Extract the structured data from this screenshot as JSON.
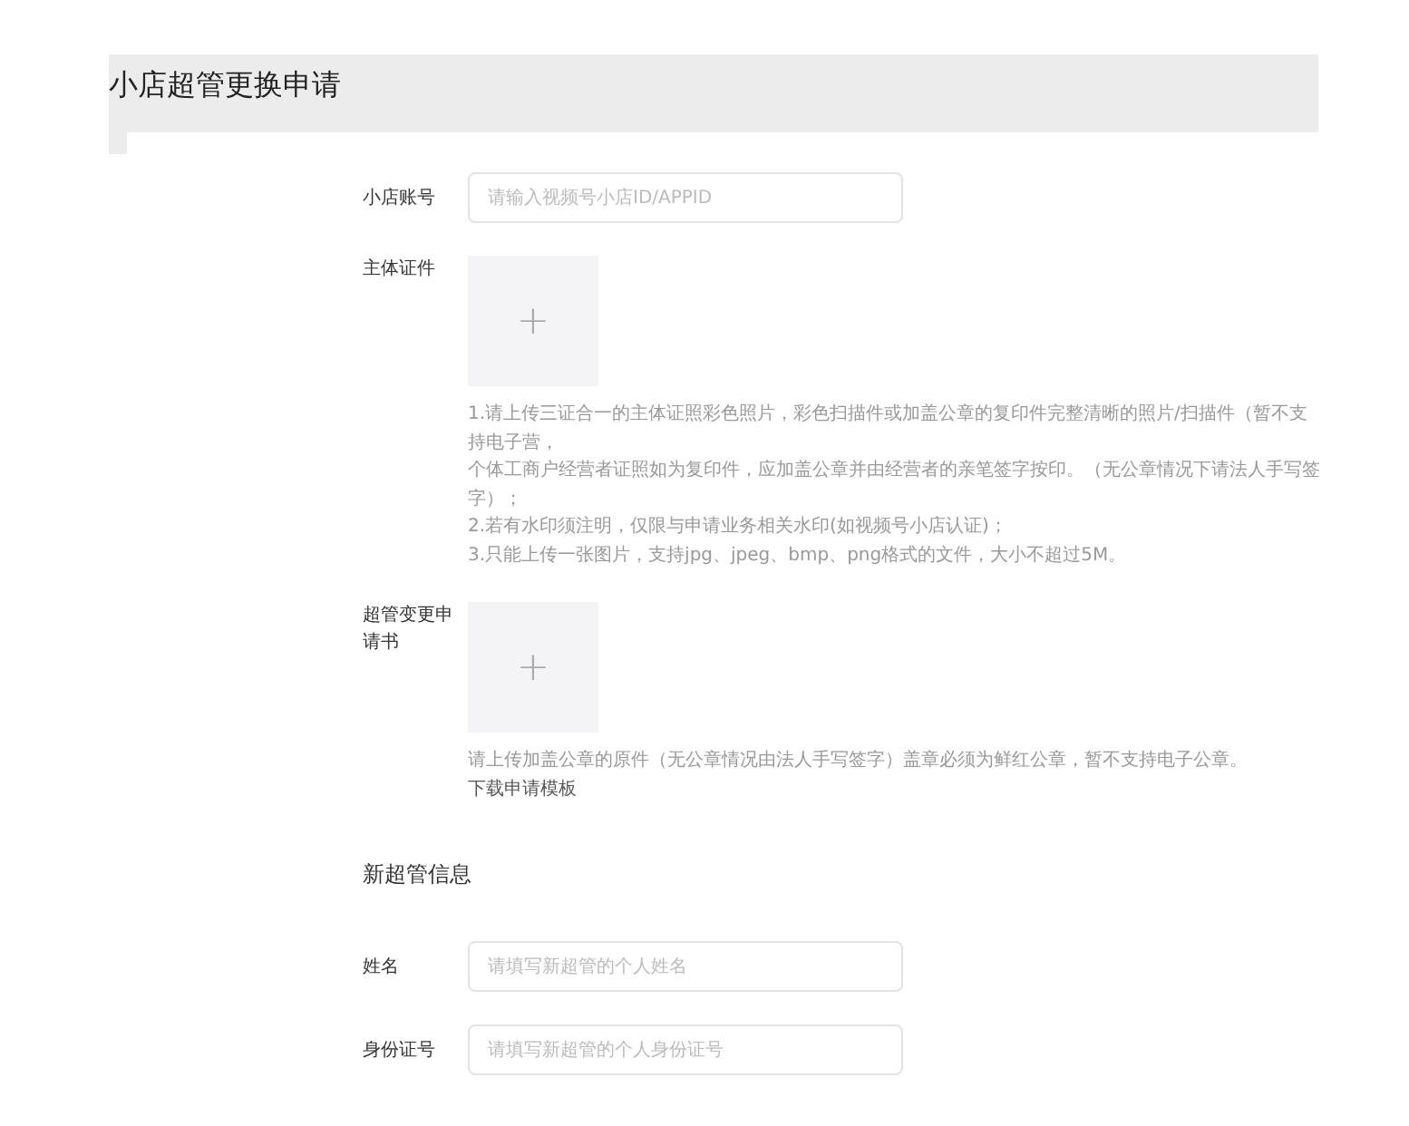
{
  "page": {
    "title": "小店超管更换申请"
  },
  "form": [
    {
      "kind": "input",
      "label": "小店账号",
      "placeholder": "请输入视频号小店ID/APPID"
    },
    {
      "kind": "upload",
      "label": "主体证件",
      "symbol": "+",
      "notes": [
        "1.请上传三证合一的主体证照彩色照片，彩色扫描件或加盖公章的复印件完整清晰的照片/扫描件（暂不支持电子营，",
        "个体工商户经营者证照如为复印件，应加盖公章并由经营者的亲笔签字按印。（无公章情况下请法人手写签字）；",
        "2.若有水印须注明，仅限与申请业务相关水印(如视频号小店认证)；",
        "3.只能上传一张图片，支持jpg、jpeg、bmp、png格式的文件，大小不超过5M。"
      ]
    },
    {
      "kind": "upload",
      "label": "超管变更申请书",
      "symbol": "+",
      "notes": [
        "请上传加盖公章的原件（无公章情况由法人手写签字）盖章必须为鲜红公章，暂不支持电子公章。"
      ],
      "link": "下载申请模板"
    },
    {
      "kind": "heading",
      "label": "新超管信息"
    },
    {
      "kind": "input",
      "label": "姓名",
      "placeholder": "请填写新超管的个人姓名"
    },
    {
      "kind": "input",
      "label": "身份证号",
      "placeholder": "请填写新超管的个人身份证号"
    }
  ]
}
